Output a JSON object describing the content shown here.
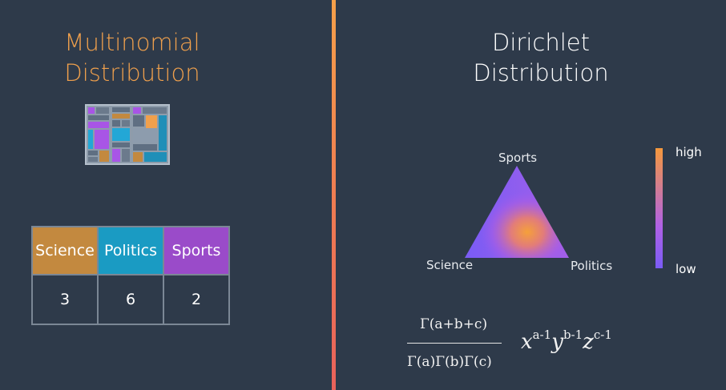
{
  "left": {
    "title_line1": "Multinomial",
    "title_line2": "Distribution",
    "table": {
      "headers": [
        {
          "label": "Science",
          "color": "#c3893f"
        },
        {
          "label": "Politics",
          "color": "#1a9bc3"
        },
        {
          "label": "Sports",
          "color": "#9a4bc9"
        }
      ],
      "values": [
        "3",
        "6",
        "2"
      ]
    }
  },
  "right": {
    "title_line1": "Dirichlet",
    "title_line2": "Distribution",
    "triangle": {
      "top_label": "Sports",
      "left_label": "Science",
      "right_label": "Politics"
    },
    "colorbar": {
      "high_label": "high",
      "low_label": "low",
      "high_color": "#f5983c",
      "low_color": "#7a5cf5"
    },
    "formula": {
      "numerator": "Γ(a+b+c)",
      "denominator": "Γ(a)Γ(b)Γ(c)",
      "x": "x",
      "x_exp": "a-1",
      "y": "y",
      "y_exp": "b-1",
      "z": "z",
      "z_exp": "c-1"
    }
  },
  "colors": {
    "background": "#2e3a4a",
    "orange": "#f0a04c",
    "divider": "#ef7d52"
  }
}
